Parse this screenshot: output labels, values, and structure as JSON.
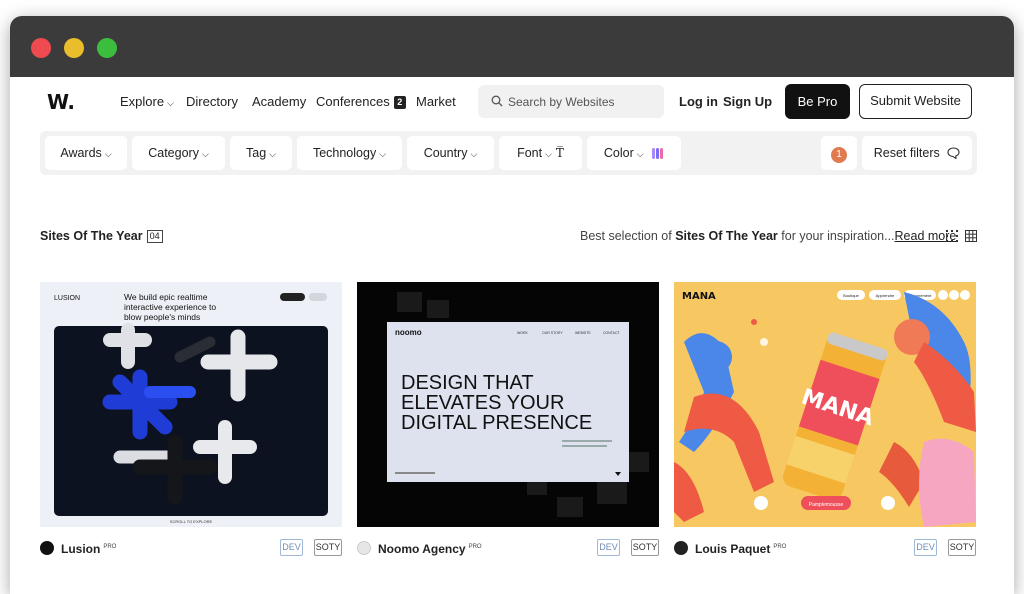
{
  "nav": {
    "logo": "W.",
    "links": [
      "Explore",
      "Directory",
      "Academy",
      "Conferences",
      "Market"
    ],
    "conferences_badge": "2",
    "search_placeholder": "Search by Websites",
    "login": "Log in",
    "signup": "Sign Up",
    "be_pro": "Be Pro",
    "submit": "Submit Website"
  },
  "filters": {
    "items": [
      "Awards",
      "Category",
      "Tag",
      "Technology",
      "Country",
      "Font",
      "Color"
    ],
    "active_count": "1",
    "reset": "Reset filters",
    "color_swatches": [
      "#a78bfa",
      "#7c6cf2",
      "#ec6aa8"
    ]
  },
  "section": {
    "title": "Sites Of The Year",
    "count": "04",
    "desc_prefix": "Best selection of ",
    "desc_bold": "Sites Of The Year",
    "desc_suffix": " for your inspiration...",
    "read_more": "Read more"
  },
  "cards": [
    {
      "name": "Lusion",
      "pro": "PRO",
      "tags": [
        "DEV",
        "SOTY"
      ],
      "thumb": {
        "brand": "LUSION",
        "headline": [
          "We build epic realtime",
          "interactive experience to",
          "blow people's minds"
        ],
        "scroll": "SCROLL TO EXPLORE"
      }
    },
    {
      "name": "Noomo Agency",
      "pro": "PRO",
      "tags": [
        "DEV",
        "SOTY"
      ],
      "thumb": {
        "brand": "noomo",
        "menu": [
          "WORK",
          "OUR STORY",
          "WEBSITE",
          "CONTACT"
        ],
        "headline": [
          "DESIGN THAT",
          "ELEVATES YOUR",
          "DIGITAL PRESENCE"
        ]
      }
    },
    {
      "name": "Louis Paquet",
      "pro": "PRO",
      "tags": [
        "DEV",
        "SOTY"
      ],
      "thumb": {
        "brand": "MANA",
        "can": "MANA",
        "buttons": [
          "Boutique",
          "Apprendre",
          "Abonnement"
        ],
        "cta": "Pamplemousse"
      }
    }
  ],
  "colors": {
    "accent_dark": "#111111",
    "badge_orange": "#e07b50",
    "dev_tag": "#6d8db5"
  }
}
